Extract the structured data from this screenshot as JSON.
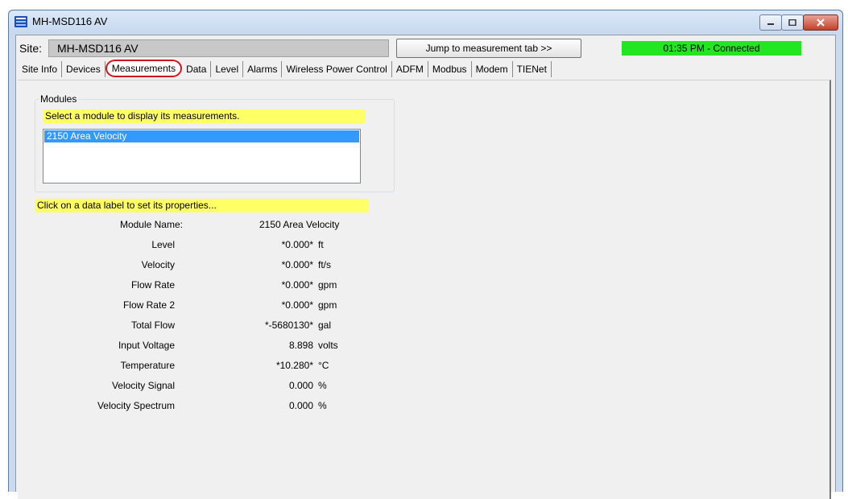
{
  "window": {
    "title": "MH-MSD116 AV",
    "colors": {
      "status_bg": "#22e622",
      "hint_bg": "#ffff66",
      "selection": "#3399ff",
      "annotation": "#d0161c"
    }
  },
  "site": {
    "label": "Site:",
    "value": "MH-MSD116 AV",
    "jump_button": "Jump to measurement tab >>",
    "status": "01:35 PM - Connected"
  },
  "tabs": [
    {
      "label": "Site Info"
    },
    {
      "label": "Devices"
    },
    {
      "label": "Measurements",
      "active": true
    },
    {
      "label": "Data"
    },
    {
      "label": "Level"
    },
    {
      "label": "Alarms"
    },
    {
      "label": "Wireless Power Control"
    },
    {
      "label": "ADFM"
    },
    {
      "label": "Modbus"
    },
    {
      "label": "Modem"
    },
    {
      "label": "TIENet"
    }
  ],
  "modules": {
    "group_label": "Modules",
    "hint": "Select a module to display its measurements.",
    "items": [
      "2150 Area Velocity"
    ]
  },
  "properties_hint": "Click on a data label to set its properties...",
  "measurements": {
    "module_name_label": "Module Name:",
    "module_name_value": "2150 Area Velocity",
    "rows": [
      {
        "label": "Level",
        "value": "*0.000*",
        "unit": "ft"
      },
      {
        "label": "Velocity",
        "value": "*0.000*",
        "unit": "ft/s"
      },
      {
        "label": "Flow Rate",
        "value": "*0.000*",
        "unit": "gpm"
      },
      {
        "label": "Flow Rate 2",
        "value": "*0.000*",
        "unit": "gpm"
      },
      {
        "label": "Total Flow",
        "value": "*-5680130*",
        "unit": "gal"
      },
      {
        "label": "Input Voltage",
        "value": "8.898",
        "unit": "volts"
      },
      {
        "label": "Temperature",
        "value": "*10.280*",
        "unit": "°C"
      },
      {
        "label": "Velocity Signal",
        "value": "0.000",
        "unit": "%"
      },
      {
        "label": "Velocity Spectrum",
        "value": "0.000",
        "unit": "%"
      }
    ]
  }
}
